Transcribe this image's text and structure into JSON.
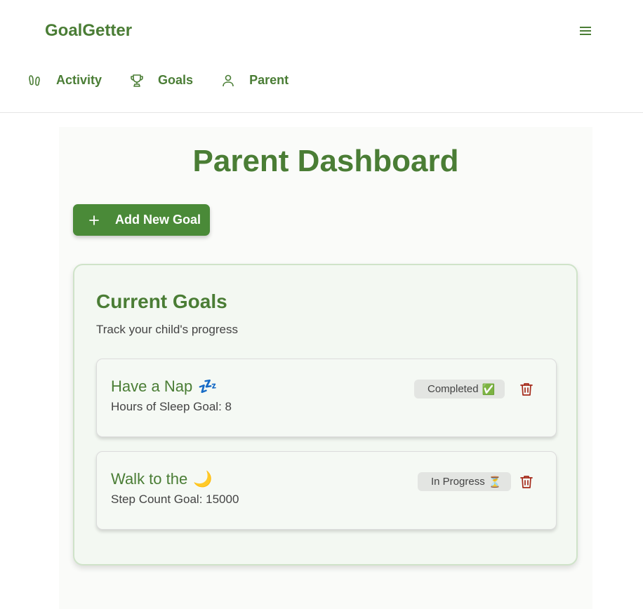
{
  "header": {
    "brand": "GoalGetter",
    "menu_icon": "hamburger-menu-icon",
    "nav": [
      {
        "label": "Activity",
        "icon": "footprints-icon"
      },
      {
        "label": "Goals",
        "icon": "trophy-icon"
      },
      {
        "label": "Parent",
        "icon": "user-icon"
      }
    ]
  },
  "main": {
    "title": "Parent Dashboard",
    "add_button": {
      "label": "Add New Goal",
      "icon": "plus-icon"
    },
    "card": {
      "title": "Current Goals",
      "subtitle": "Track your child's progress",
      "goals": [
        {
          "title": "Have a Nap",
          "emoji": "💤",
          "description": "Hours of Sleep Goal: 8",
          "status": "Completed",
          "status_emoji": "✅",
          "delete_icon": "trash-icon"
        },
        {
          "title": "Walk to the",
          "emoji": "🌙",
          "description": "Step Count Goal: 15000",
          "status": "In Progress",
          "status_emoji": "⏳",
          "delete_icon": "trash-icon"
        }
      ]
    }
  },
  "colors": {
    "brand_green": "#4a7d35",
    "button_green": "#4a8a38",
    "card_bg": "#f3f8f2",
    "card_border": "#cfe3c9",
    "delete_red": "#a52a1a",
    "badge_bg": "#e3e5e2"
  }
}
